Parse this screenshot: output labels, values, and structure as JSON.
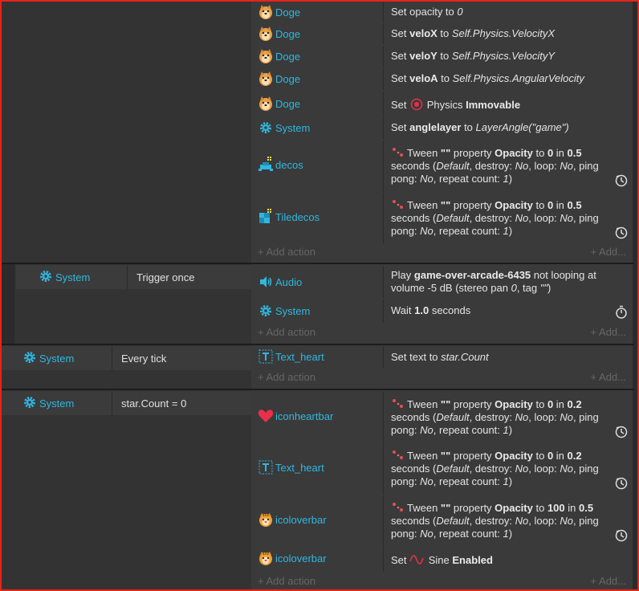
{
  "colors": {
    "accent": "#2fb7e0",
    "frame": "#e5251b",
    "bg": "#2b2b2b",
    "action_bg": "#3a3a3a"
  },
  "labels": {
    "add_action": "Add action",
    "add_condition": "Add..."
  },
  "block1": {
    "actions": [
      {
        "object": "Doge",
        "icon": "doge-icon",
        "desc": "Set opacity to <i>0</i>"
      },
      {
        "object": "Doge",
        "icon": "doge-icon",
        "desc": "Set <b>veloX</b> to <i>Self.Physics.VelocityX</i>"
      },
      {
        "object": "Doge",
        "icon": "doge-icon",
        "desc": "Set <b>veloY</b> to <i>Self.Physics.VelocityY</i>"
      },
      {
        "object": "Doge",
        "icon": "doge-icon",
        "desc": "Set <b>veloA</b> to <i>Self.Physics.AngularVelocity</i>"
      },
      {
        "object": "Doge",
        "icon": "doge-icon",
        "desc": "Set <span class=\"phys\"></span> Physics <b>Immovable</b>"
      },
      {
        "object": "System",
        "icon": "gear-icon",
        "desc": "Set <b>anglelayer</b> to <i>LayerAngle(\"game\")</i>"
      },
      {
        "object": "decos",
        "icon": "decos-icon",
        "desc": "Tween <b>\"\"</b> property <b>Opacity</b> to <b>0</b> in <b>0.5</b> seconds (<i>Default</i>, destroy: <i>No</i>, loop: <i>No</i>, ping pong: <i>No</i>, repeat count: <i>1</i>)"
      },
      {
        "object": "Tiledecos",
        "icon": "tiledecos-icon",
        "desc": "Tween <b>\"\"</b> property <b>Opacity</b> to <b>0</b> in <b>0.5</b> seconds (<i>Default</i>, destroy: <i>No</i>, loop: <i>No</i>, ping pong: <i>No</i>, repeat count: <i>1</i>)"
      }
    ]
  },
  "block2": {
    "condition": {
      "object": "System",
      "text": "Trigger once"
    },
    "actions": [
      {
        "object": "Audio",
        "icon": "speaker-icon",
        "desc": "Play <b>game-over-arcade-6435</b> not looping at volume -5 dB (stereo pan <i>0</i>, tag <i>\"\"</i>)"
      },
      {
        "object": "System",
        "icon": "gear-icon",
        "desc": "Wait <b>1.0</b> seconds"
      }
    ]
  },
  "block3": {
    "condition": {
      "object": "System",
      "text": "Every tick"
    },
    "actions": [
      {
        "object": "Text_heart",
        "icon": "text-icon",
        "desc": "Set text to <i>star.Count</i>"
      }
    ]
  },
  "block4": {
    "condition": {
      "object": "System",
      "text": "star.Count = 0"
    },
    "actions": [
      {
        "object": "iconheartbar",
        "icon": "heart-icon",
        "desc": "Tween <b>\"\"</b> property <b>Opacity</b> to <b>0</b> in <b>0.2</b> seconds (<i>Default</i>, destroy: <i>No</i>, loop: <i>No</i>, ping pong: <i>No</i>, repeat count: <i>1</i>)"
      },
      {
        "object": "Text_heart",
        "icon": "text-icon",
        "desc": "Tween <b>\"\"</b> property <b>Opacity</b> to <b>0</b> in <b>0.2</b> seconds (<i>Default</i>, destroy: <i>No</i>, loop: <i>No</i>, ping pong: <i>No</i>, repeat count: <i>1</i>)"
      },
      {
        "object": "icoloverbar",
        "icon": "tiger-icon",
        "desc": "Tween <b>\"\"</b> property <b>Opacity</b> to <b>100</b> in <b>0.5</b> seconds (<i>Default</i>, destroy: <i>No</i>, loop: <i>No</i>, ping pong: <i>No</i>, repeat count: <i>1</i>)"
      },
      {
        "object": "icoloverbar",
        "icon": "tiger-icon",
        "desc": "Set <span class=\"sine\"></span> Sine <b>Enabled</b>"
      }
    ]
  }
}
